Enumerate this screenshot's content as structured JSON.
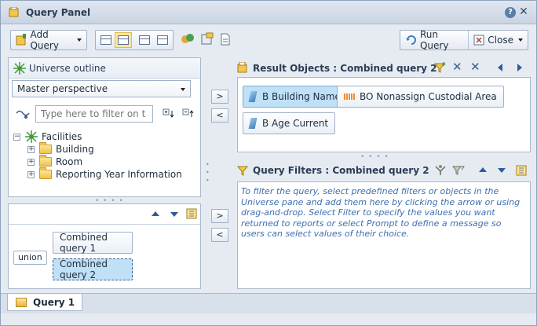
{
  "window": {
    "title": "Query Panel"
  },
  "toolbar": {
    "add_query_label": "Add Query",
    "run_query_label": "Run Query",
    "close_label": "Close"
  },
  "universe": {
    "header": "Universe outline",
    "perspective": "Master perspective",
    "filter_placeholder": "Type here to filter on t",
    "tree": [
      {
        "label": "Facilities",
        "expanded": true,
        "level": 0
      },
      {
        "label": "Building",
        "expanded": false,
        "level": 1
      },
      {
        "label": "Room",
        "expanded": false,
        "level": 1
      },
      {
        "label": "Reporting Year Information",
        "expanded": false,
        "level": 1
      }
    ]
  },
  "queries": {
    "union_label": "union",
    "items": [
      {
        "label": "Combined query 1"
      },
      {
        "label": "Combined query 2"
      }
    ]
  },
  "result_objects": {
    "header": "Result Objects : Combined query 2",
    "items": [
      {
        "label": "B Building Name",
        "kind": "dimension"
      },
      {
        "label": "BO Nonassign Custodial Area",
        "kind": "measure"
      },
      {
        "label": "B Age Current",
        "kind": "dimension"
      }
    ]
  },
  "query_filters": {
    "header": "Query Filters : Combined query 2",
    "help_text": "To filter the query, select predefined filters or objects in the Universe pane and add them here by clicking the arrow or using drag-and-drop. Select Filter to specify the values you want returned to reports or select Prompt to define a message so users can select values of their choice."
  },
  "tabs": [
    {
      "label": "Query 1"
    }
  ],
  "colors": {
    "accent": "#2f5b9a",
    "selection": "#bfe0f6",
    "filter_text": "#3d6fb0"
  }
}
